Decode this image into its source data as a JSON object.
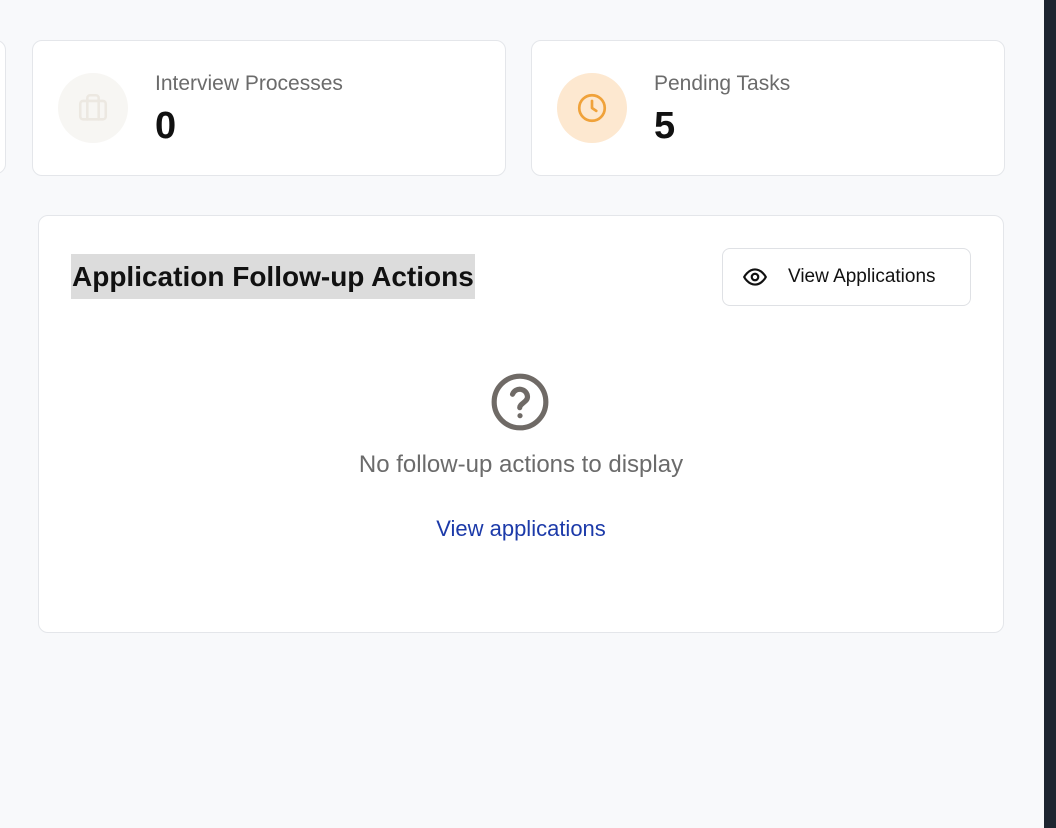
{
  "stats": [
    {
      "label": "Interview Processes",
      "value": "0",
      "icon": "briefcase-icon",
      "icon_bg": "#f7f6f3",
      "icon_color": "#ece8e1"
    },
    {
      "label": "Pending Tasks",
      "value": "5",
      "icon": "clock-icon",
      "icon_bg": "#fde8d0",
      "icon_color": "#f0a23a"
    }
  ],
  "panel": {
    "title": "Application Follow-up Actions",
    "button_label": "View Applications",
    "button_icon": "eye-icon",
    "empty_icon": "question-circle-icon",
    "empty_message": "No follow-up actions to display",
    "empty_link": "View applications",
    "link_color": "#1c3aa9"
  }
}
